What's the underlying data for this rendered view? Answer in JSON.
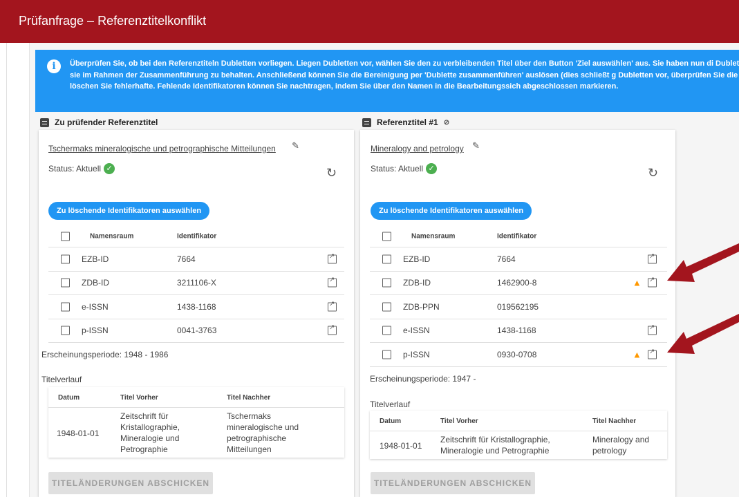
{
  "header": {
    "title": "Prüfanfrage – Referenztitelkonflikt"
  },
  "info": {
    "icon": "info-icon",
    "text": "Überprüfen Sie, ob bei den Referenztiteln Dubletten vorliegen. Liegen Dubletten vor, wählen Sie den zu verbleibenden Titel über den Button 'Ziel auswählen' aus. Sie haben nun di Dublette zu markieren, um sie im Rahmen der Zusammenführung zu behalten. Anschließend können Sie die Bereinigung per 'Dublette zusammenführen' auslösen (dies schließt g Dubletten vor, überprüfen Sie die Identifikatoren und löschen Sie fehlerhafte. Fehlende Identifikatoren können Sie nachtragen, indem Sie über den Namen in die Bearbeitungssich abgeschlossen markieren."
  },
  "left": {
    "header": "Zu prüfender Referenztitel",
    "title": "Tschermaks mineralogische und petrographische Mitteilungen",
    "status_label": "Status: Aktuell",
    "select_button": "Zu löschende Identifikatoren auswählen",
    "col_namespace": "Namensraum",
    "col_identifier": "Identifikator",
    "rows": [
      {
        "ns": "EZB-ID",
        "id": "7664"
      },
      {
        "ns": "ZDB-ID",
        "id": "3211106-X"
      },
      {
        "ns": "e-ISSN",
        "id": "1438-1168"
      },
      {
        "ns": "p-ISSN",
        "id": "0041-3763"
      }
    ],
    "period": "Erscheinungsperiode: 1948 - 1986",
    "history_label": "Titelverlauf",
    "history_cols": [
      "Datum",
      "Titel Vorher",
      "Titel Nachher"
    ],
    "history": [
      {
        "date": "1948-01-01",
        "before": "Zeitschrift für Kristallographie, Mineralogie und Petrographie",
        "after": "Tschermaks mineralogische und petrographische Mitteilungen"
      }
    ],
    "submit": "TITELÄNDERUNGEN ABSCHICKEN"
  },
  "right": {
    "header": "Referenztitel #1",
    "title": "Mineralogy and petrology",
    "status_label": "Status: Aktuell",
    "select_button": "Zu löschende Identifikatoren auswählen",
    "col_namespace": "Namensraum",
    "col_identifier": "Identifikator",
    "rows": [
      {
        "ns": "EZB-ID",
        "id": "7664"
      },
      {
        "ns": "ZDB-ID",
        "id": "1462900-8"
      },
      {
        "ns": "ZDB-PPN",
        "id": "019562195"
      },
      {
        "ns": "e-ISSN",
        "id": "1438-1168"
      },
      {
        "ns": "p-ISSN",
        "id": "0930-0708"
      }
    ],
    "period": "Erscheinungsperiode: 1947 -",
    "history_label": "Titelverlauf",
    "history_cols": [
      "Datum",
      "Titel Vorher",
      "Titel Nachher"
    ],
    "history": [
      {
        "date": "1948-01-01",
        "before": "Zeitschrift für Kristallographie, Mineralogie und Petrographie",
        "after": "Mineralogy and petrology"
      }
    ],
    "submit": "TITELÄNDERUNGEN ABSCHICKEN"
  },
  "colors": {
    "brand": "#a3151e",
    "info": "#2196f3",
    "success": "#4caf50",
    "warning": "#ff9800",
    "arrow": "#a3151e"
  }
}
